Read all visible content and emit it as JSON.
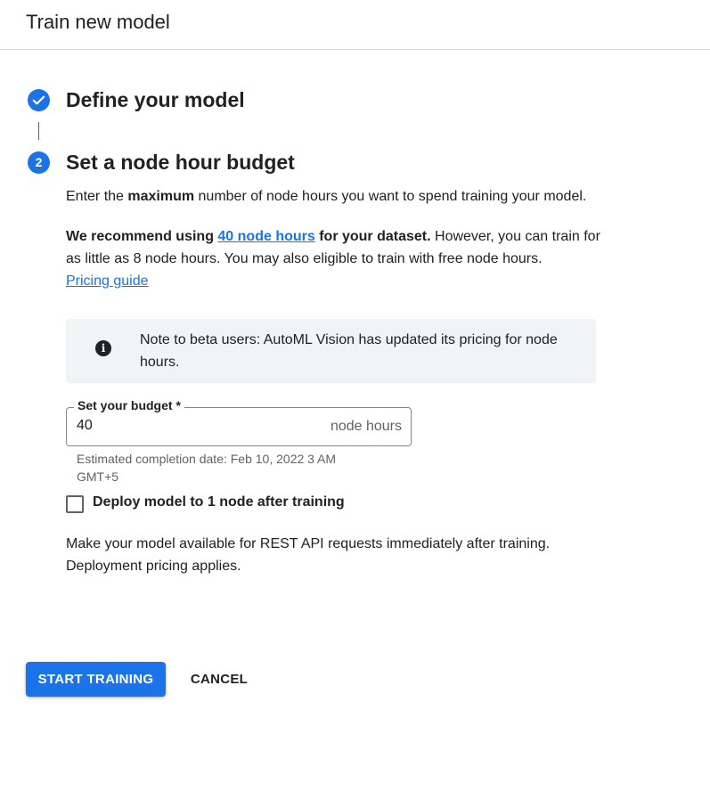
{
  "header": {
    "title": "Train new model"
  },
  "steps": [
    {
      "number": "",
      "title": "Define your model",
      "status": "complete",
      "icon": "check-icon"
    },
    {
      "number": "2",
      "title": "Set a node hour budget",
      "status": "active"
    }
  ],
  "intro": {
    "prefix": "Enter the ",
    "bold": "maximum",
    "suffix": " number of node hours you want to spend training your model."
  },
  "recommendation": {
    "lead": "We recommend using ",
    "link": "40 node hours",
    "lead_end": " for your dataset.",
    "rest": " However, you can train for as little as 8 node hours. You may also eligible to train with free node hours."
  },
  "pricing_link": "Pricing guide",
  "note": {
    "icon": "info-icon",
    "text": "Note to beta users: AutoML Vision has updated its pricing for node hours."
  },
  "budget": {
    "label": "Set your budget *",
    "value": "40",
    "suffix": "node hours",
    "hint": "Estimated completion date: Feb 10, 2022 3 AM GMT+5"
  },
  "deploy": {
    "checkbox_label": "Deploy model to 1 node after training",
    "checked": false,
    "description": "Make your model available for REST API requests immediately after training. Deployment pricing applies."
  },
  "actions": {
    "start": "START TRAINING",
    "cancel": "CANCEL"
  },
  "colors": {
    "accent": "#1a73e8",
    "note_bg": "#f1f3f4"
  }
}
